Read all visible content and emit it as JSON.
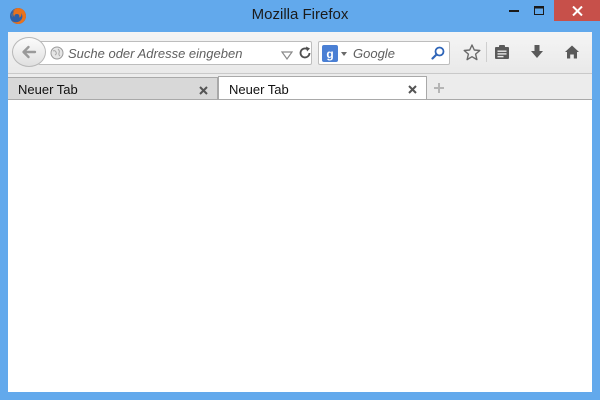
{
  "window": {
    "title": "Mozilla Firefox"
  },
  "navbar": {
    "url_placeholder": "Suche oder Adresse eingeben",
    "search_placeholder": "Google",
    "search_engine": "Google"
  },
  "tabs": [
    {
      "label": "Neuer Tab",
      "active": false
    },
    {
      "label": "Neuer Tab",
      "active": true
    }
  ],
  "colors": {
    "titlebar": "#62a9ec",
    "close_button": "#c7504a",
    "toolbar_icon": "#5a5a5a"
  },
  "icons": {
    "app": "firefox-logo-icon",
    "minimize": "minimize-icon",
    "maximize": "maximize-icon",
    "close": "close-icon",
    "back": "back-arrow-icon",
    "identity": "globe-icon",
    "dropmarker": "dropdown-triangle-icon",
    "reload": "reload-icon",
    "search_engine": "google-logo-icon",
    "search_go": "magnifier-icon",
    "bookmark": "star-icon",
    "bookmarks_menu": "clipboard-icon",
    "downloads": "download-arrow-icon",
    "home": "home-icon",
    "tab_close": "tab-close-icon",
    "new_tab": "plus-icon"
  }
}
